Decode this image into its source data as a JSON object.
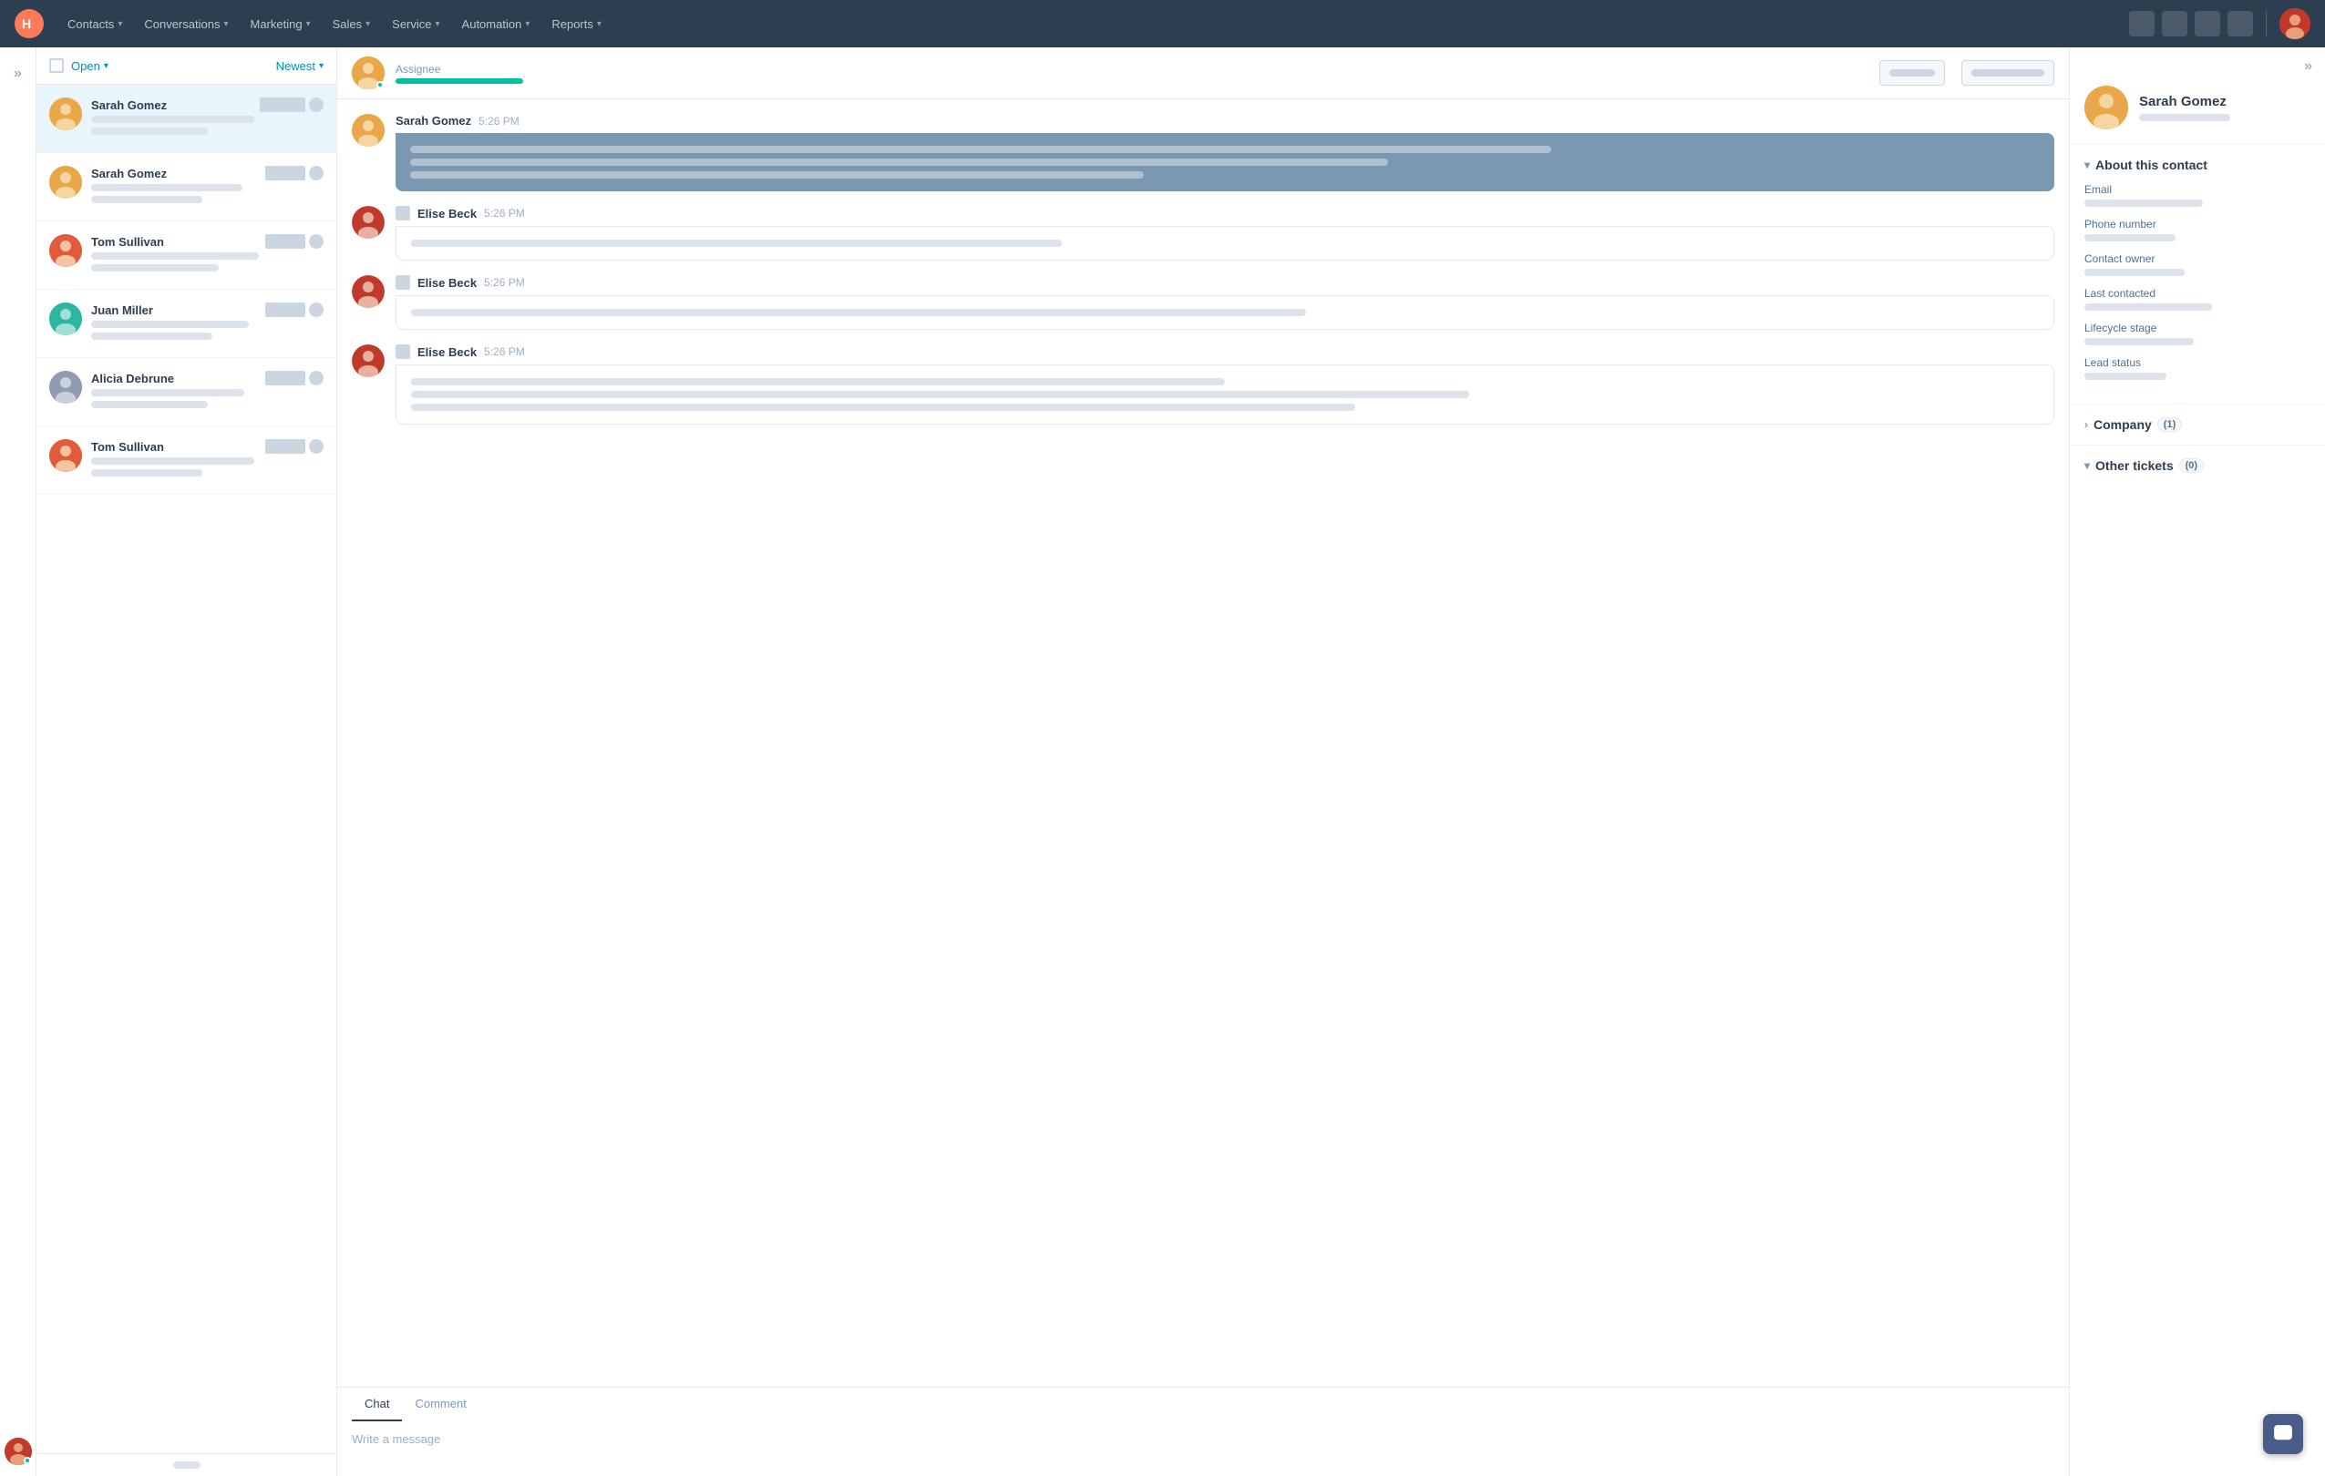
{
  "nav": {
    "items": [
      {
        "label": "Contacts",
        "id": "contacts"
      },
      {
        "label": "Conversations",
        "id": "conversations"
      },
      {
        "label": "Marketing",
        "id": "marketing"
      },
      {
        "label": "Sales",
        "id": "sales"
      },
      {
        "label": "Service",
        "id": "service"
      },
      {
        "label": "Automation",
        "id": "automation"
      },
      {
        "label": "Reports",
        "id": "reports"
      }
    ]
  },
  "conv_list": {
    "filter1": "Open",
    "filter2": "Newest",
    "items": [
      {
        "name": "Sarah Gomez",
        "av_class": "av-sarah1",
        "active": true
      },
      {
        "name": "Sarah Gomez",
        "av_class": "av-sarah2",
        "active": false
      },
      {
        "name": "Tom Sullivan",
        "av_class": "av-tom",
        "active": false
      },
      {
        "name": "Juan Miller",
        "av_class": "av-juan",
        "active": false
      },
      {
        "name": "Alicia Debrune",
        "av_class": "av-alicia",
        "active": false
      },
      {
        "name": "Tom Sullivan",
        "av_class": "av-tom2",
        "active": false
      }
    ]
  },
  "chat": {
    "assignee_label": "Assignee",
    "messages": [
      {
        "sender": "Sarah Gomez",
        "time": "5:26 PM",
        "type": "sarah",
        "lines": [
          70,
          60,
          45
        ]
      },
      {
        "sender": "Elise Beck",
        "time": "5:26 PM",
        "type": "other",
        "lines": [
          40
        ]
      },
      {
        "sender": "Elise Beck",
        "time": "5:26 PM",
        "type": "other",
        "lines": [
          55
        ]
      },
      {
        "sender": "Elise Beck",
        "time": "5:26 PM",
        "type": "other",
        "lines": [
          50,
          65,
          58
        ]
      }
    ],
    "tabs": [
      "Chat",
      "Comment"
    ],
    "active_tab": "Chat",
    "input_placeholder": "Write a message"
  },
  "right_panel": {
    "contact_name": "Sarah Gomez",
    "sections": {
      "about": {
        "title": "About this contact",
        "fields": [
          {
            "label": "Email",
            "width": 130
          },
          {
            "label": "Phone number",
            "width": 100
          },
          {
            "label": "Contact owner",
            "width": 110
          },
          {
            "label": "Last contacted",
            "width": 140
          },
          {
            "label": "Lifecycle stage",
            "width": 120
          },
          {
            "label": "Lead status",
            "width": 90
          }
        ]
      },
      "company": {
        "title": "Company",
        "count": "(1)"
      },
      "other_tickets": {
        "title": "Other tickets",
        "count": "(0)"
      }
    }
  }
}
